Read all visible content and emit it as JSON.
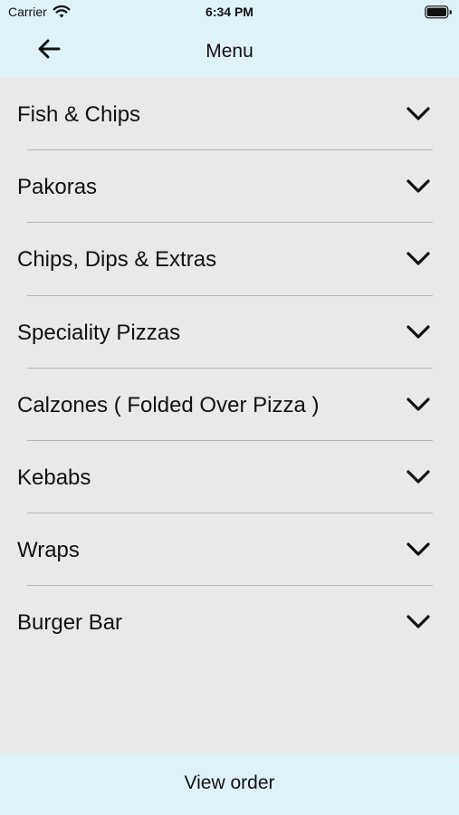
{
  "status_bar": {
    "carrier": "Carrier",
    "time": "6:34 PM"
  },
  "nav": {
    "title": "Menu"
  },
  "menu": {
    "items": [
      {
        "label": "Fish & Chips"
      },
      {
        "label": "Pakoras"
      },
      {
        "label": "Chips, Dips & Extras"
      },
      {
        "label": "Speciality Pizzas"
      },
      {
        "label": "Calzones ( Folded Over Pizza )"
      },
      {
        "label": "Kebabs"
      },
      {
        "label": "Wraps"
      },
      {
        "label": "Burger Bar"
      }
    ]
  },
  "footer": {
    "view_order_label": "View order"
  }
}
